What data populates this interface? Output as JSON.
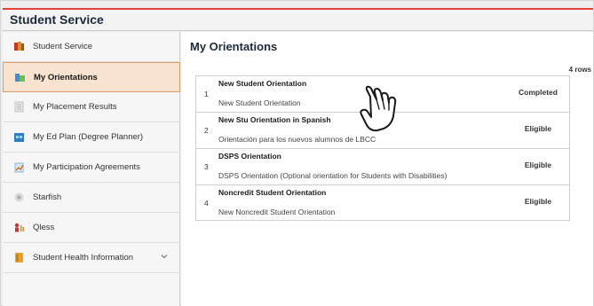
{
  "app": {
    "title": "Student Service"
  },
  "sidebar": {
    "items": [
      {
        "label": "Student Service",
        "icon": "people-icon"
      },
      {
        "label": "My Orientations",
        "icon": "orientation-icon",
        "active": true
      },
      {
        "label": "My Placement Results",
        "icon": "document-icon"
      },
      {
        "label": "My Ed Plan (Degree Planner)",
        "icon": "planner-icon"
      },
      {
        "label": "My Participation Agreements",
        "icon": "agreement-icon"
      },
      {
        "label": "Starfish",
        "icon": "starfish-icon"
      },
      {
        "label": "Qless",
        "icon": "queue-icon"
      },
      {
        "label": "Student Health Information",
        "icon": "health-icon"
      }
    ]
  },
  "main": {
    "title": "My Orientations",
    "row_count": "4 rows",
    "orientations": [
      {
        "num": "1",
        "title": "New Student Orientation",
        "description": "New Student Orientation",
        "status": "Completed"
      },
      {
        "num": "2",
        "title": "New Stu Orientation in Spanish",
        "description": "Orientación para los nuevos alumnos de LBCC",
        "status": "Eligible"
      },
      {
        "num": "3",
        "title": "DSPS Orientation",
        "description": "DSPS Orientation (Optional orientation for Students with Disabilities)",
        "status": "Eligible"
      },
      {
        "num": "4",
        "title": "Noncredit Student Orientation",
        "description": "New Noncredit Student Orientation",
        "status": "Eligible"
      }
    ]
  },
  "colors": {
    "accent_red": "#e6403a",
    "active_bg": "#f7e3cf",
    "active_border": "#d79c6a"
  }
}
